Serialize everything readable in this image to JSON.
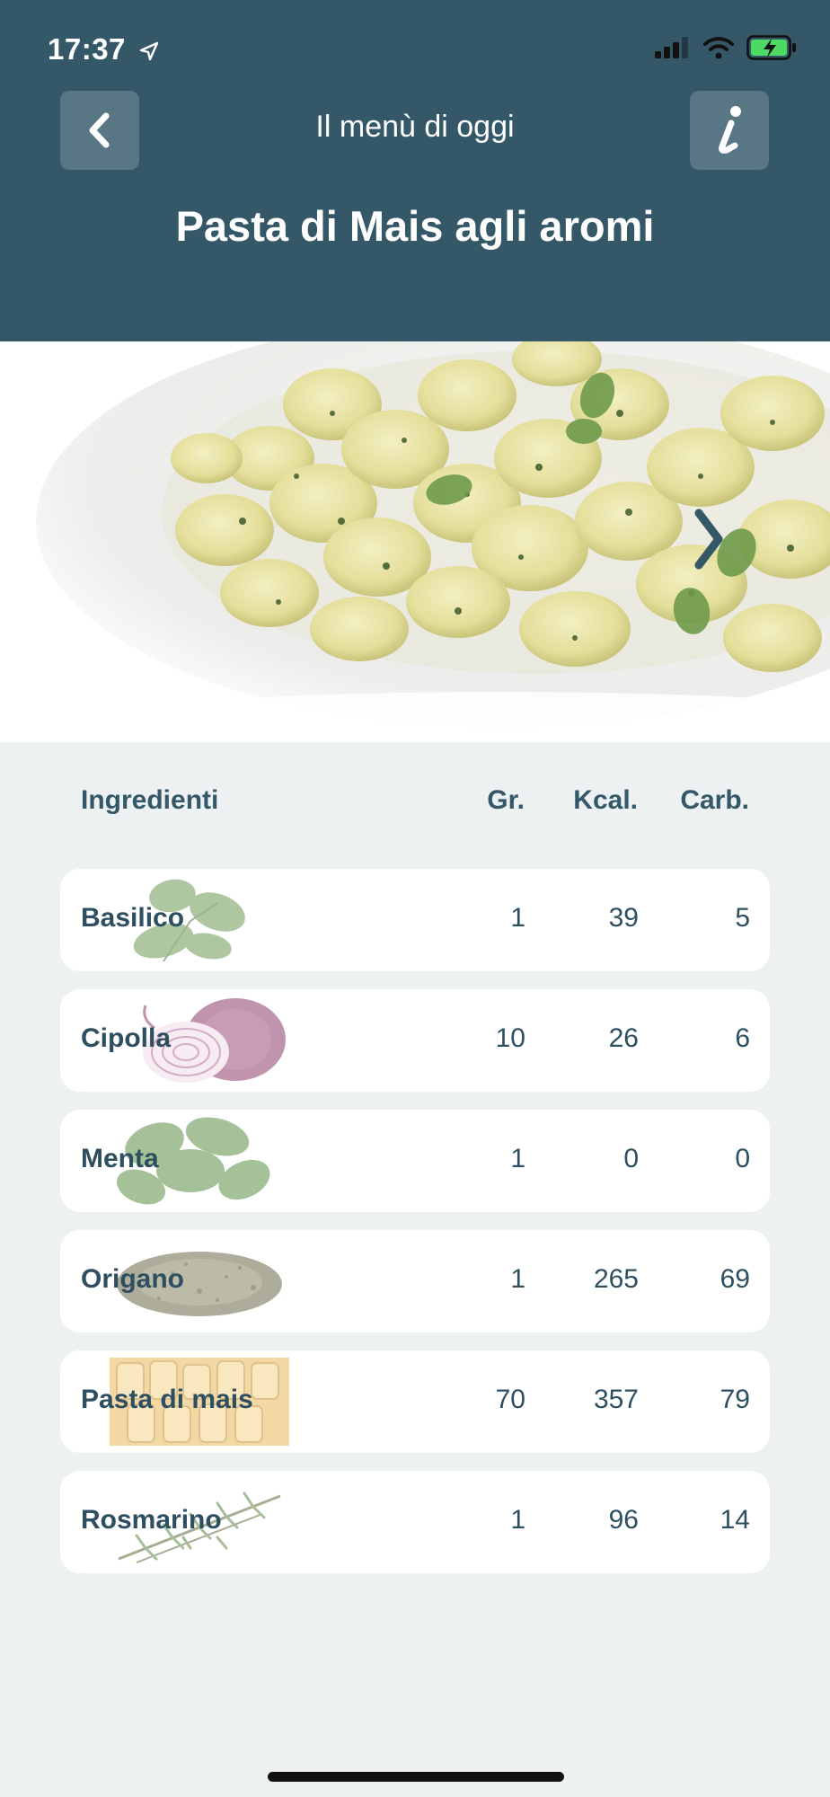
{
  "status_bar": {
    "time": "17:37"
  },
  "header": {
    "subtitle": "Il menù di oggi",
    "title": "Pasta di Mais agli aromi"
  },
  "table": {
    "headers": {
      "ingredient": "Ingredienti",
      "grams": "Gr.",
      "kcal": "Kcal.",
      "carbs": "Carb."
    },
    "rows": [
      {
        "name": "Basilico",
        "grams": "1",
        "kcal": "39",
        "carbs": "5",
        "icon": "basil"
      },
      {
        "name": "Cipolla",
        "grams": "10",
        "kcal": "26",
        "carbs": "6",
        "icon": "onion"
      },
      {
        "name": "Menta",
        "grams": "1",
        "kcal": "0",
        "carbs": "0",
        "icon": "mint"
      },
      {
        "name": "Origano",
        "grams": "1",
        "kcal": "265",
        "carbs": "69",
        "icon": "oregano"
      },
      {
        "name": "Pasta di mais",
        "grams": "70",
        "kcal": "357",
        "carbs": "79",
        "icon": "pasta"
      },
      {
        "name": "Rosmarino",
        "grams": "1",
        "kcal": "96",
        "carbs": "14",
        "icon": "rosemary"
      }
    ]
  },
  "colors": {
    "header_bg": "#355869",
    "page_bg": "#eef1f2",
    "text": "#2d4f60"
  }
}
